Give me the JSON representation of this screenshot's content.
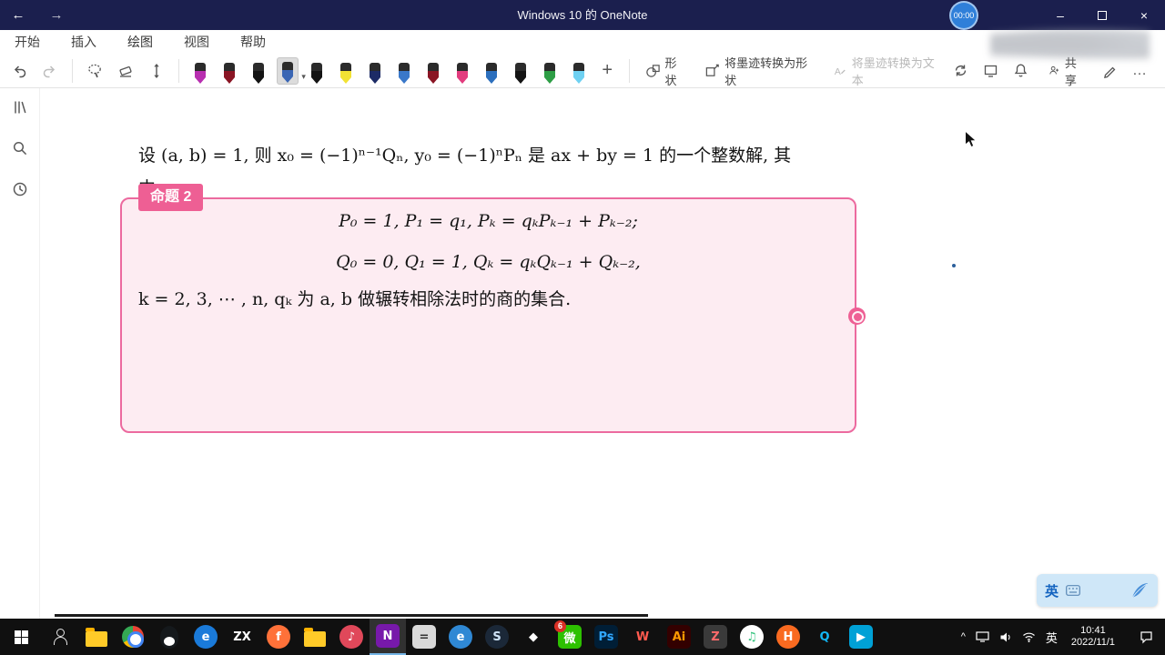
{
  "titlebar": {
    "back": "←",
    "forward": "→",
    "title": "Windows 10 的 OneNote",
    "recording_timer": "00:00",
    "minimize": "–",
    "close": "×"
  },
  "ribbon": {
    "tabs": [
      {
        "label": "开始",
        "active": false
      },
      {
        "label": "插入",
        "active": false
      },
      {
        "label": "绘图",
        "active": true
      },
      {
        "label": "视图",
        "active": false
      },
      {
        "label": "帮助",
        "active": false
      }
    ],
    "pens": [
      {
        "color": "#b82fb0"
      },
      {
        "color": "#8a1524"
      },
      {
        "color": "#141414"
      },
      {
        "color": "#3a66b4",
        "selected": true
      },
      {
        "color": "#141414"
      },
      {
        "color": "#f2e234"
      },
      {
        "color": "#1d2b66"
      },
      {
        "color": "#3a78c9"
      },
      {
        "color": "#8a1524"
      },
      {
        "color": "#e23c7e"
      },
      {
        "color": "#2c6fbd"
      },
      {
        "color": "#141414"
      },
      {
        "color": "#2e9e46"
      },
      {
        "color": "#6fd1f2"
      }
    ],
    "add_pen": "+",
    "shapes_label": "形状",
    "ink_to_shape_label": "将墨迹转换为形状",
    "ink_to_text_label": "将墨迹转换为文本",
    "share_label": "共享",
    "more": "…"
  },
  "note": {
    "proposition_tag": "命题 2",
    "line1": "设 (a, b) = 1, 则 x₀ = (−1)ⁿ⁻¹Qₙ, y₀ = (−1)ⁿPₙ 是 ax + by = 1 的一个整数解, 其",
    "line2": "中",
    "formula_p": "P₀ = 1, P₁ = q₁, Pₖ = qₖPₖ₋₁ + Pₖ₋₂;",
    "formula_q": "Q₀ = 0, Q₁ = 1, Qₖ = qₖQₖ₋₁ + Qₖ₋₂,",
    "line3": "k = 2, 3, ⋯ , n, qₖ 为 a, b 做辗转相除法时的商的集合."
  },
  "ime_panel": {
    "lang": "英"
  },
  "taskbar": {
    "apps": [
      {
        "name": "people",
        "kind": "person"
      },
      {
        "name": "file-explorer",
        "kind": "folder"
      },
      {
        "name": "chrome",
        "kind": "chrome"
      },
      {
        "name": "qq",
        "kind": "qq"
      },
      {
        "name": "blue-e-app",
        "kind": "glyph",
        "glyph": "e",
        "bg": "#1a7ad9",
        "fg": "#ffffff",
        "round": true
      },
      {
        "name": "zx-app",
        "kind": "glyph",
        "glyph": "ZX",
        "bg": "",
        "fg": "#ffffff"
      },
      {
        "name": "firefox",
        "kind": "glyph",
        "glyph": "f",
        "bg": "#ff7139",
        "fg": "#ffffff",
        "round": true
      },
      {
        "name": "folder-2",
        "kind": "folder"
      },
      {
        "name": "music-pink",
        "kind": "glyph",
        "glyph": "♪",
        "bg": "#e0485a",
        "fg": "#ffffff",
        "round": true
      },
      {
        "name": "onenote",
        "kind": "glyph",
        "glyph": "N",
        "bg": "#7719aa",
        "fg": "#ffffff",
        "active": true
      },
      {
        "name": "calculator",
        "kind": "glyph",
        "glyph": "=",
        "bg": "#d9d9d9",
        "fg": "#333333"
      },
      {
        "name": "edge",
        "kind": "glyph",
        "glyph": "e",
        "bg": "#2f88d4",
        "fg": "#ffffff",
        "round": true
      },
      {
        "name": "steam",
        "kind": "glyph",
        "glyph": "S",
        "bg": "#1b2838",
        "fg": "#cfe4f7",
        "round": true
      },
      {
        "name": "diamond-app",
        "kind": "glyph",
        "glyph": "◆",
        "bg": "",
        "fg": "#ffffff"
      },
      {
        "name": "wechat",
        "kind": "glyph",
        "glyph": "微",
        "bg": "#2dc100",
        "fg": "#ffffff",
        "badge": "6"
      },
      {
        "name": "photoshop",
        "kind": "glyph",
        "glyph": "Ps",
        "bg": "#001e36",
        "fg": "#31a8ff"
      },
      {
        "name": "word-w",
        "kind": "glyph",
        "glyph": "W",
        "bg": "",
        "fg": "#ff5b4f"
      },
      {
        "name": "illustrator",
        "kind": "glyph",
        "glyph": "Ai",
        "bg": "#330000",
        "fg": "#ff9a00"
      },
      {
        "name": "dark-z-app",
        "kind": "glyph",
        "glyph": "Z",
        "bg": "#3a3a3a",
        "fg": "#ff6b6b"
      },
      {
        "name": "qq-music",
        "kind": "glyph",
        "glyph": "♫",
        "bg": "#ffffff",
        "fg": "#31c27c",
        "round": true
      },
      {
        "name": "orange-app",
        "kind": "glyph",
        "glyph": "H",
        "bg": "#f96a20",
        "fg": "#ffffff",
        "round": true
      },
      {
        "name": "qq-browser",
        "kind": "glyph",
        "glyph": "Q",
        "bg": "",
        "fg": "#12b7f5"
      },
      {
        "name": "bilibili",
        "kind": "glyph",
        "glyph": "▶",
        "bg": "#00a1d6",
        "fg": "#ffffff"
      }
    ],
    "tray": {
      "expand": "^",
      "lang": "英",
      "time": "10:41",
      "date": "2022/11/1"
    }
  }
}
